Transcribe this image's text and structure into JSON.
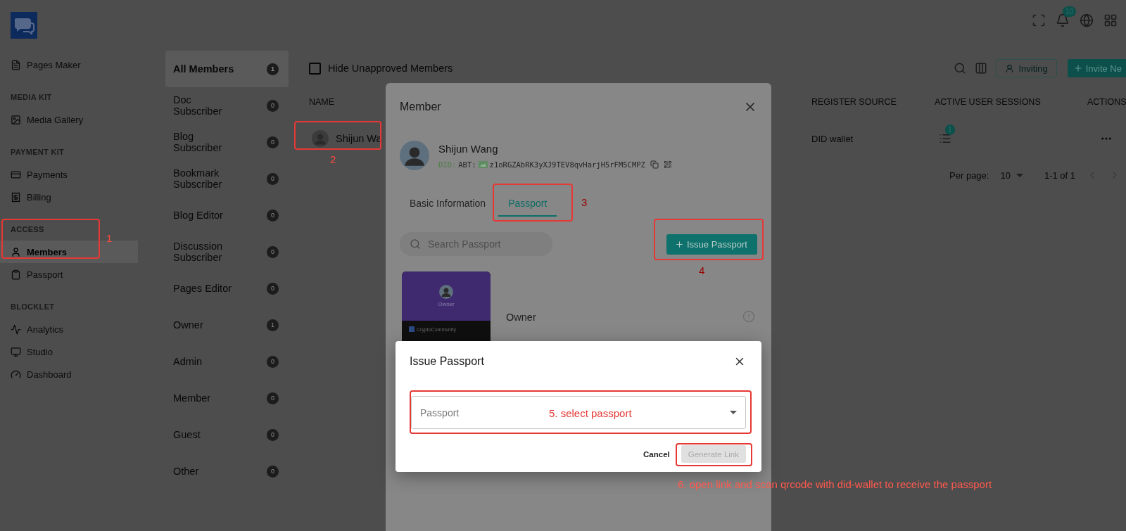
{
  "header": {
    "notification_count": "10"
  },
  "sidebar": {
    "sections": [
      {
        "items": [
          {
            "label": "Pages Maker",
            "selected": false
          }
        ]
      },
      {
        "heading": "MEDIA KIT",
        "items": [
          {
            "label": "Media Gallery",
            "selected": false
          }
        ]
      },
      {
        "heading": "PAYMENT KIT",
        "items": [
          {
            "label": "Payments",
            "selected": false
          },
          {
            "label": "Billing",
            "selected": false
          }
        ]
      },
      {
        "heading": "ACCESS",
        "items": [
          {
            "label": "Members",
            "selected": true
          },
          {
            "label": "Passport",
            "selected": false
          }
        ]
      },
      {
        "heading": "BLOCKLET",
        "items": [
          {
            "label": "Analytics",
            "selected": false
          },
          {
            "label": "Studio",
            "selected": false
          },
          {
            "label": "Dashboard",
            "selected": false
          }
        ]
      }
    ]
  },
  "filters": [
    {
      "label": "All Members",
      "count": "1",
      "selected": true
    },
    {
      "label": "Doc Subscriber",
      "count": "0",
      "selected": false
    },
    {
      "label": "Blog Subscriber",
      "count": "0",
      "selected": false
    },
    {
      "label": "Bookmark Subscriber",
      "count": "0",
      "selected": false
    },
    {
      "label": "Blog Editor",
      "count": "0",
      "selected": false
    },
    {
      "label": "Discussion Subscriber",
      "count": "0",
      "selected": false
    },
    {
      "label": "Pages Editor",
      "count": "0",
      "selected": false
    },
    {
      "label": "Owner",
      "count": "1",
      "selected": false
    },
    {
      "label": "Admin",
      "count": "0",
      "selected": false
    },
    {
      "label": "Member",
      "count": "0",
      "selected": false
    },
    {
      "label": "Guest",
      "count": "0",
      "selected": false
    },
    {
      "label": "Other",
      "count": "0",
      "selected": false
    }
  ],
  "main": {
    "hide_unapproved": {
      "label": "Hide Unapproved Members",
      "checked": false
    },
    "inviting_button": "Inviting",
    "invite_button": "Invite Ne",
    "table": {
      "columns": [
        "NAME",
        "REGISTER SOURCE",
        "ACTIVE USER SESSIONS",
        "ACTIONS"
      ],
      "rows": [
        {
          "name": "Shijun Wa",
          "register_source": "DID wallet",
          "sessions": "1"
        }
      ]
    },
    "pagination": {
      "per_page_label": "Per page:",
      "per_page": "10",
      "range": "1-1 of 1"
    }
  },
  "member_dialog": {
    "title": "Member",
    "user": {
      "name": "Shijun Wang",
      "did_prefix": "DID:",
      "did_scheme": "ABT:",
      "did": "z1oRGZAbRK3yXJ9TEV8qvHarjH5rFM5CMPZ"
    },
    "tabs": [
      {
        "label": "Basic Information",
        "selected": false
      },
      {
        "label": "Passport",
        "selected": true
      }
    ],
    "search": {
      "placeholder": "Search Passport"
    },
    "issue_button": "Issue Passport",
    "passports": [
      {
        "card_title": "Owner",
        "card_issuer": "CryptoCommunity",
        "name": "Owner"
      }
    ]
  },
  "issue_dialog": {
    "title": "Issue Passport",
    "select": {
      "placeholder": "Passport"
    },
    "cancel": "Cancel",
    "generate": {
      "label": "Generate Link",
      "disabled": true
    }
  },
  "annotations": [
    {
      "kind": "box"
    },
    {
      "kind": "number",
      "text": "1"
    },
    {
      "kind": "box"
    },
    {
      "kind": "number",
      "text": "2"
    },
    {
      "kind": "box"
    },
    {
      "kind": "number",
      "text": "3"
    },
    {
      "kind": "box"
    },
    {
      "kind": "number",
      "text": "4"
    },
    {
      "kind": "box"
    },
    {
      "kind": "note",
      "text": "5. select passport"
    },
    {
      "kind": "box"
    },
    {
      "kind": "note",
      "text": "6. open link and scan qrcode with did-wallet to receive the passport"
    }
  ]
}
